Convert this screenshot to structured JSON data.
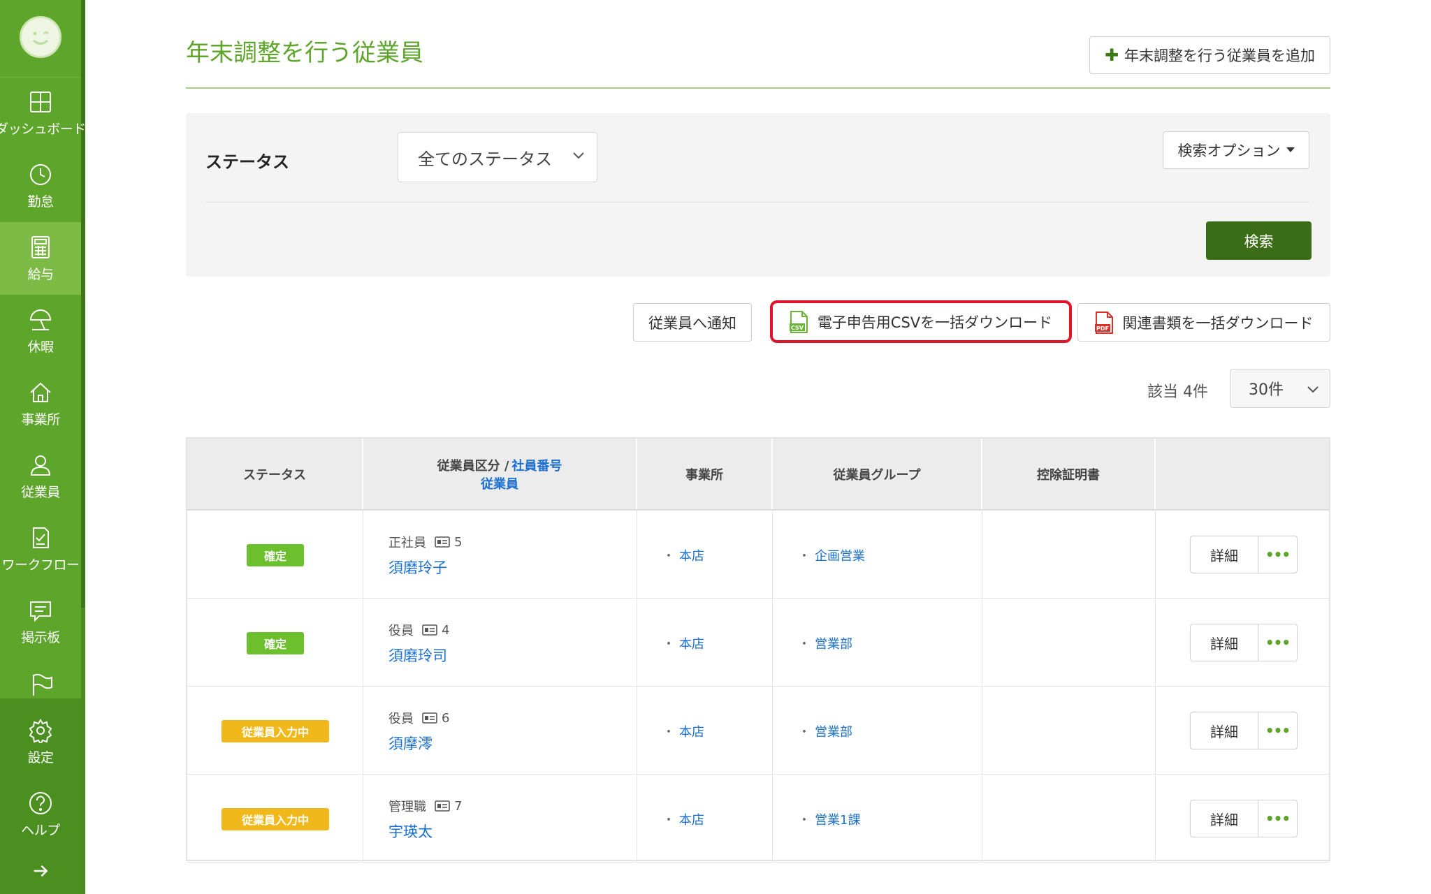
{
  "sidebar": {
    "items": [
      {
        "label": "ダッシュボード",
        "icon": "dashboard-icon"
      },
      {
        "label": "勤怠",
        "icon": "clock-icon"
      },
      {
        "label": "給与",
        "icon": "calculator-icon"
      },
      {
        "label": "休暇",
        "icon": "umbrella-icon"
      },
      {
        "label": "事業所",
        "icon": "home-icon"
      },
      {
        "label": "従業員",
        "icon": "user-icon"
      },
      {
        "label": "ワークフロー",
        "icon": "checklist-icon"
      },
      {
        "label": "掲示板",
        "icon": "message-icon"
      },
      {
        "label": "",
        "icon": "flag-icon"
      },
      {
        "label": "設定",
        "icon": "gear-icon"
      },
      {
        "label": "ヘルプ",
        "icon": "help-icon"
      },
      {
        "label": "",
        "icon": "arrow-right-icon"
      }
    ],
    "active": "給与"
  },
  "header": {
    "title": "年末調整を行う従業員",
    "add_button": "年末調整を行う従業員を追加"
  },
  "search": {
    "status_label": "ステータス",
    "status_value": "全てのステータス",
    "options_button": "検索オプション",
    "search_button": "検索"
  },
  "actions": {
    "notify": "従業員へ通知",
    "csv_download": "電子申告用CSVを一括ダウンロード",
    "pdf_download": "関連書類を一括ダウンロード",
    "csv_icon_text": "CSV",
    "pdf_icon_text": "PDF"
  },
  "results": {
    "count": "該当 4件",
    "per_page": "30件"
  },
  "table": {
    "headers": {
      "status": "ステータス",
      "category_prefix": "従業員区分 / ",
      "employee_no": "社員番号",
      "employee": "従業員",
      "office": "事業所",
      "group": "従業員グループ",
      "certificate": "控除証明書"
    },
    "rows": [
      {
        "status": "確定",
        "status_color": "#6cc02e",
        "type": "正社員",
        "no": "5",
        "name": "須磨玲子",
        "office": "本店",
        "group": "企画営業",
        "detail": "詳細"
      },
      {
        "status": "確定",
        "status_color": "#6cc02e",
        "type": "役員",
        "no": "4",
        "name": "須磨玲司",
        "office": "本店",
        "group": "営業部",
        "detail": "詳細"
      },
      {
        "status": "従業員入力中",
        "status_color": "#f0b81b",
        "type": "役員",
        "no": "6",
        "name": "須摩澪",
        "office": "本店",
        "group": "営業部",
        "detail": "詳細"
      },
      {
        "status": "従業員入力中",
        "status_color": "#f0b81b",
        "type": "管理職",
        "no": "7",
        "name": "宇瑛太",
        "office": "本店",
        "group": "営業1課",
        "detail": "詳細"
      }
    ]
  },
  "colors": {
    "sidebar": "#5ea52c",
    "accent_green": "#5ea52c",
    "primary_button": "#3b6c17",
    "link": "#1a6fd1",
    "highlight_border": "#e0142b"
  }
}
